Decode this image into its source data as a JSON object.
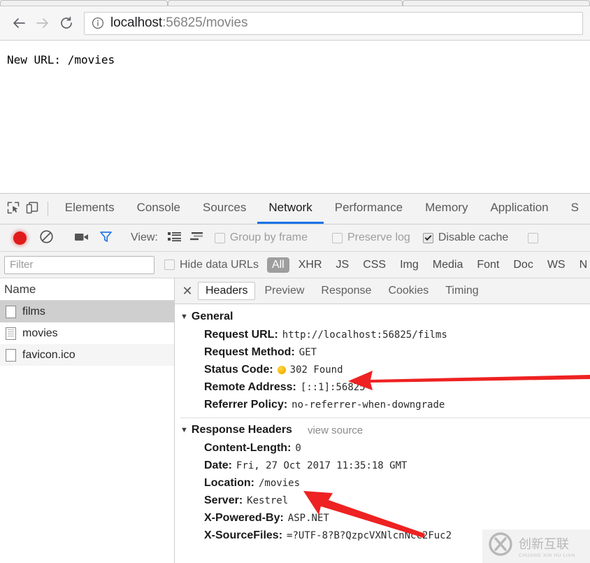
{
  "browser": {
    "nav": {
      "back_icon": "arrow-left-icon",
      "forward_icon": "arrow-right-icon",
      "reload_icon": "reload-icon"
    },
    "omnibox": {
      "security_icon": "info-circle-icon",
      "url_host": "localhost",
      "url_rest": ":56825/movies",
      "full_url": "localhost:56825/movies"
    }
  },
  "page": {
    "body_text": "New URL: /movies"
  },
  "devtools": {
    "tools": {
      "inspect_icon": "inspect-element-icon",
      "device_icon": "device-toolbar-icon"
    },
    "tabs": [
      {
        "label": "Elements",
        "active": false
      },
      {
        "label": "Console",
        "active": false
      },
      {
        "label": "Sources",
        "active": false
      },
      {
        "label": "Network",
        "active": true
      },
      {
        "label": "Performance",
        "active": false
      },
      {
        "label": "Memory",
        "active": false
      },
      {
        "label": "Application",
        "active": false
      },
      {
        "label": "S",
        "active": false
      }
    ],
    "controls": {
      "record_icon": "record-button",
      "clear_icon": "clear-icon",
      "camera_icon": "capture-screenshots-icon",
      "filter_icon": "filter-funnel-icon",
      "view_label": "View:",
      "view_list_icon": "view-list-icon",
      "view_waterfall_icon": "view-waterfall-icon",
      "group_by_frame": {
        "label": "Group by frame",
        "checked": false
      },
      "preserve_log": {
        "label": "Preserve log",
        "checked": false
      },
      "disable_cache": {
        "label": "Disable cache",
        "checked": true
      }
    },
    "filterbar": {
      "filter_placeholder": "Filter",
      "filter_value": "",
      "hide_data_urls": {
        "label": "Hide data URLs",
        "checked": false
      },
      "types": [
        {
          "label": "All",
          "selected": true
        },
        {
          "label": "XHR",
          "selected": false
        },
        {
          "label": "JS",
          "selected": false
        },
        {
          "label": "CSS",
          "selected": false
        },
        {
          "label": "Img",
          "selected": false
        },
        {
          "label": "Media",
          "selected": false
        },
        {
          "label": "Font",
          "selected": false
        },
        {
          "label": "Doc",
          "selected": false
        },
        {
          "label": "WS",
          "selected": false
        },
        {
          "label": "N",
          "selected": false
        }
      ]
    },
    "request_list": {
      "column_header": "Name",
      "rows": [
        {
          "name": "films",
          "icon": "blank-file-icon",
          "selected": true
        },
        {
          "name": "movies",
          "icon": "document-file-icon",
          "selected": false
        },
        {
          "name": "favicon.ico",
          "icon": "blank-file-icon",
          "selected": false
        }
      ]
    },
    "detail": {
      "close_icon": "close-icon",
      "tabs": [
        {
          "label": "Headers",
          "active": true
        },
        {
          "label": "Preview",
          "active": false
        },
        {
          "label": "Response",
          "active": false
        },
        {
          "label": "Cookies",
          "active": false
        },
        {
          "label": "Timing",
          "active": false
        }
      ],
      "general": {
        "title": "General",
        "rows": [
          {
            "name": "Request URL:",
            "value": "http://localhost:56825/films"
          },
          {
            "name": "Request Method:",
            "value": "GET"
          },
          {
            "name": "Status Code:",
            "value": "302 Found",
            "status_dot": "yellow-status-dot"
          },
          {
            "name": "Remote Address:",
            "value": "[::1]:56825"
          },
          {
            "name": "Referrer Policy:",
            "value": "no-referrer-when-downgrade"
          }
        ]
      },
      "response_headers": {
        "title": "Response Headers",
        "view_source": "view source",
        "rows": [
          {
            "name": "Content-Length:",
            "value": "0"
          },
          {
            "name": "Date:",
            "value": "Fri, 27 Oct 2017 11:35:18 GMT"
          },
          {
            "name": "Location:",
            "value": "/movies"
          },
          {
            "name": "Server:",
            "value": "Kestrel"
          },
          {
            "name": "X-Powered-By:",
            "value": "ASP.NET"
          },
          {
            "name": "X-SourceFiles:",
            "value": "=?UTF-8?B?QzpcVXNlcnNcc2Fuc2"
          }
        ]
      }
    }
  },
  "annotations": {
    "arrow_color": "#ee2222",
    "arrow_status_code": "red-arrow-status-code",
    "arrow_location": "red-arrow-location"
  },
  "watermark": {
    "logo": "cx-logo-icon",
    "text_cn": "创新互联",
    "text_en": "CHUANG XIN HU LIAN"
  }
}
